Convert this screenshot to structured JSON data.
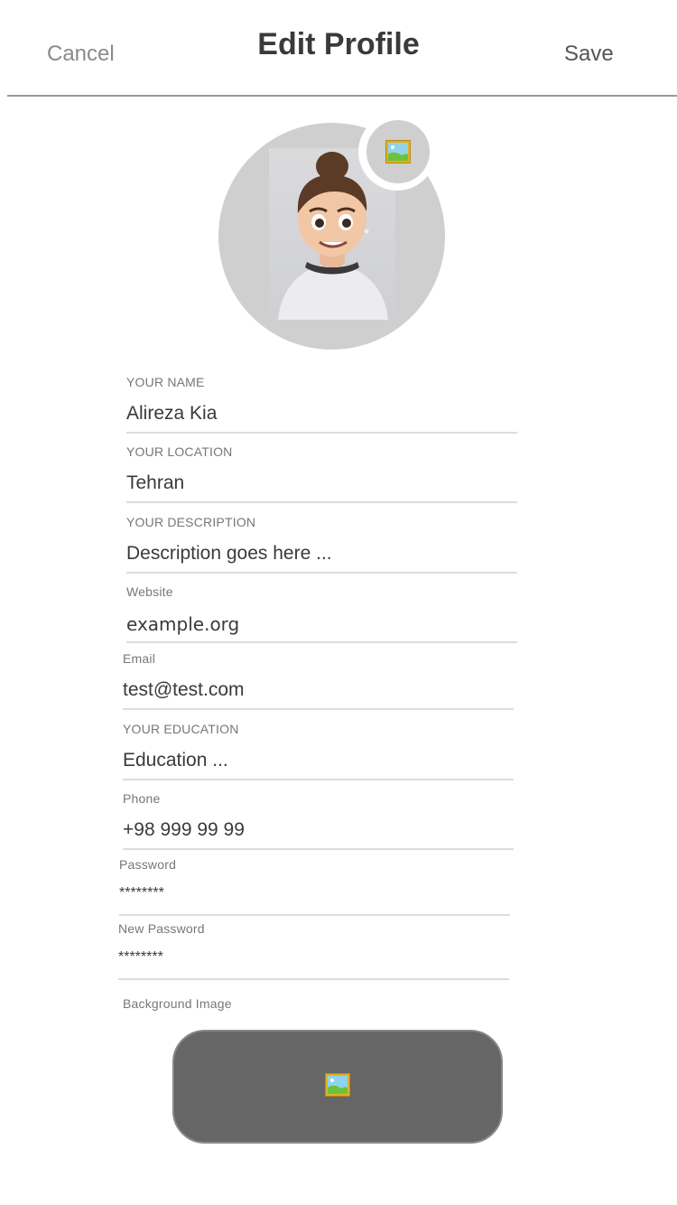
{
  "header": {
    "cancel_label": "Cancel",
    "title": "Edit Profile",
    "save_label": "Save"
  },
  "avatar": {
    "icon": "image-icon",
    "badge_icon": "image-icon"
  },
  "fields": {
    "name": {
      "label": "YOUR NAME",
      "value": "Alireza Kia"
    },
    "location": {
      "label": "YOUR LOCATION",
      "value": "Tehran"
    },
    "description": {
      "label": "YOUR DESCRIPTION",
      "value": "Description goes here ..."
    },
    "website": {
      "label": "Website",
      "value": "example.org"
    },
    "email": {
      "label": "Email",
      "value": "test@test.com"
    },
    "education": {
      "label": "YOUR EDUCATION",
      "value": "Education ..."
    },
    "phone": {
      "label": "Phone",
      "value": "+98 999 99 99"
    },
    "password": {
      "label": "Password",
      "value": "********"
    },
    "new_password": {
      "label": "New Password",
      "value": "********"
    }
  },
  "background_image": {
    "label": "Background Image",
    "icon": "image-icon"
  },
  "colors": {
    "header_divider": "#9a9a9a",
    "avatar_bg": "#cfcfcf",
    "button_bg": "#666666"
  }
}
